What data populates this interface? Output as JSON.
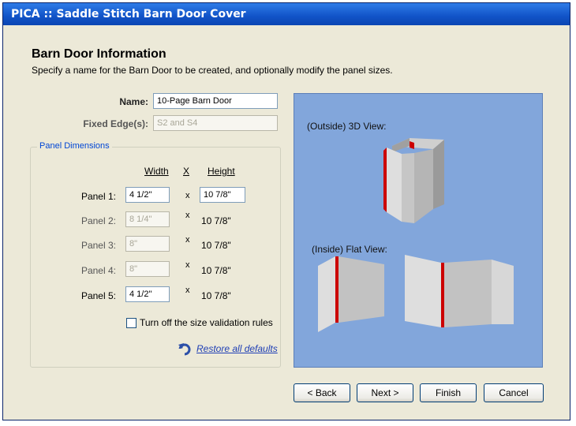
{
  "window": {
    "title": "PICA :: Saddle Stitch Barn Door Cover"
  },
  "header": {
    "title": "Barn Door Information",
    "subtitle": "Specify a name for the Barn Door to be created, and optionally modify the panel sizes."
  },
  "form": {
    "name_label": "Name:",
    "name_value": "10-Page Barn Door",
    "fixed_edges_label": "Fixed Edge(s):",
    "fixed_edges_value": "S2 and S4"
  },
  "panel_dimensions": {
    "legend": "Panel Dimensions",
    "width_header": "Width",
    "x_header": "X",
    "height_header": "Height",
    "times_symbol": "x",
    "panels": [
      {
        "label": "Panel 1:",
        "width": "4 1/2\"",
        "height": "10 7/8\""
      },
      {
        "label": "Panel 2:",
        "width": "8 1/4\"",
        "height": "10 7/8\""
      },
      {
        "label": "Panel 3:",
        "width": "8\"",
        "height": "10 7/8\""
      },
      {
        "label": "Panel 4:",
        "width": "8\"",
        "height": "10 7/8\""
      },
      {
        "label": "Panel 5:",
        "width": "4 1/2\"",
        "height": "10 7/8\""
      }
    ],
    "validation_checkbox_label": "Turn off the size validation rules",
    "validation_checked": false,
    "restore_link": "Restore all defaults"
  },
  "preview": {
    "outside_label": "(Outside) 3D View:",
    "inside_label": "(Inside) Flat View:",
    "background_color": "#82a6db",
    "stitch_color": "#cc0000"
  },
  "buttons": {
    "back": "< Back",
    "next": "Next >",
    "finish": "Finish",
    "cancel": "Cancel"
  }
}
